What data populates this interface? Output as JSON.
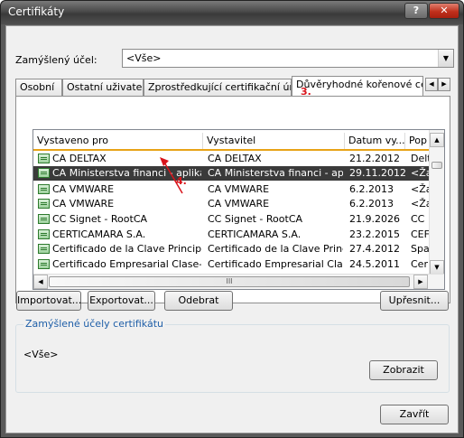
{
  "window": {
    "title": "Certifikáty",
    "help_label": "?",
    "close_label": "✕"
  },
  "purpose": {
    "label": "Zamýšlený účel:",
    "value": "<Vše>"
  },
  "tabs": [
    {
      "label": "Osobní"
    },
    {
      "label": "Ostatní uživatelé"
    },
    {
      "label": "Zprostředkující certifikační úřady"
    },
    {
      "label": "Důvěryhodné kořenové cert"
    }
  ],
  "annotations": {
    "tab_step": "3.",
    "row_step": "4."
  },
  "list": {
    "columns": [
      "Vystaveno pro",
      "Vystavitel",
      "Datum vy...",
      "Pop"
    ],
    "rows": [
      {
        "issued_to": "CA DELTAX",
        "issuer": "CA DELTAX",
        "date": "21.2.2012",
        "purpose": "Delt"
      },
      {
        "issued_to": "CA Ministerstva financi - aplikace",
        "issuer": "CA Ministerstva financi - apl...",
        "date": "29.11.2012",
        "purpose": "<Ža"
      },
      {
        "issued_to": "CA VMWARE",
        "issuer": "CA VMWARE",
        "date": "6.2.2013",
        "purpose": "<Ža"
      },
      {
        "issued_to": "CA VMWARE",
        "issuer": "CA VMWARE",
        "date": "6.2.2013",
        "purpose": "<Ža"
      },
      {
        "issued_to": "CC Signet - RootCA",
        "issuer": "CC Signet - RootCA",
        "date": "21.9.2026",
        "purpose": "CC"
      },
      {
        "issued_to": "CERTICAMARA S.A.",
        "issuer": "CERTICAMARA S.A.",
        "date": "23.2.2015",
        "purpose": "CEF"
      },
      {
        "issued_to": "Certificado de la Clave Principal",
        "issuer": "Certificado de la Clave Princ...",
        "date": "27.4.2012",
        "purpose": "Spa"
      },
      {
        "issued_to": "Certificado Empresarial Clase-A",
        "issuer": "Certificado Empresarial Clas...",
        "date": "24.5.2011",
        "purpose": "Cer"
      }
    ],
    "selected_index": 1,
    "hscroll_thumb_label": "III"
  },
  "buttons": {
    "import": "Importovat...",
    "export": "Exportovat...",
    "remove": "Odebrat",
    "advanced": "Upřesnit...",
    "view": "Zobrazit",
    "close": "Zavřít"
  },
  "purposes_group": {
    "title": "Zamýšlené účely certifikátu",
    "value": "<Vše>"
  },
  "colors": {
    "annotation": "#d8141b",
    "selection": "#3a3a3a",
    "header_underline": "#e8a317",
    "group_title": "#1f5fa8"
  }
}
